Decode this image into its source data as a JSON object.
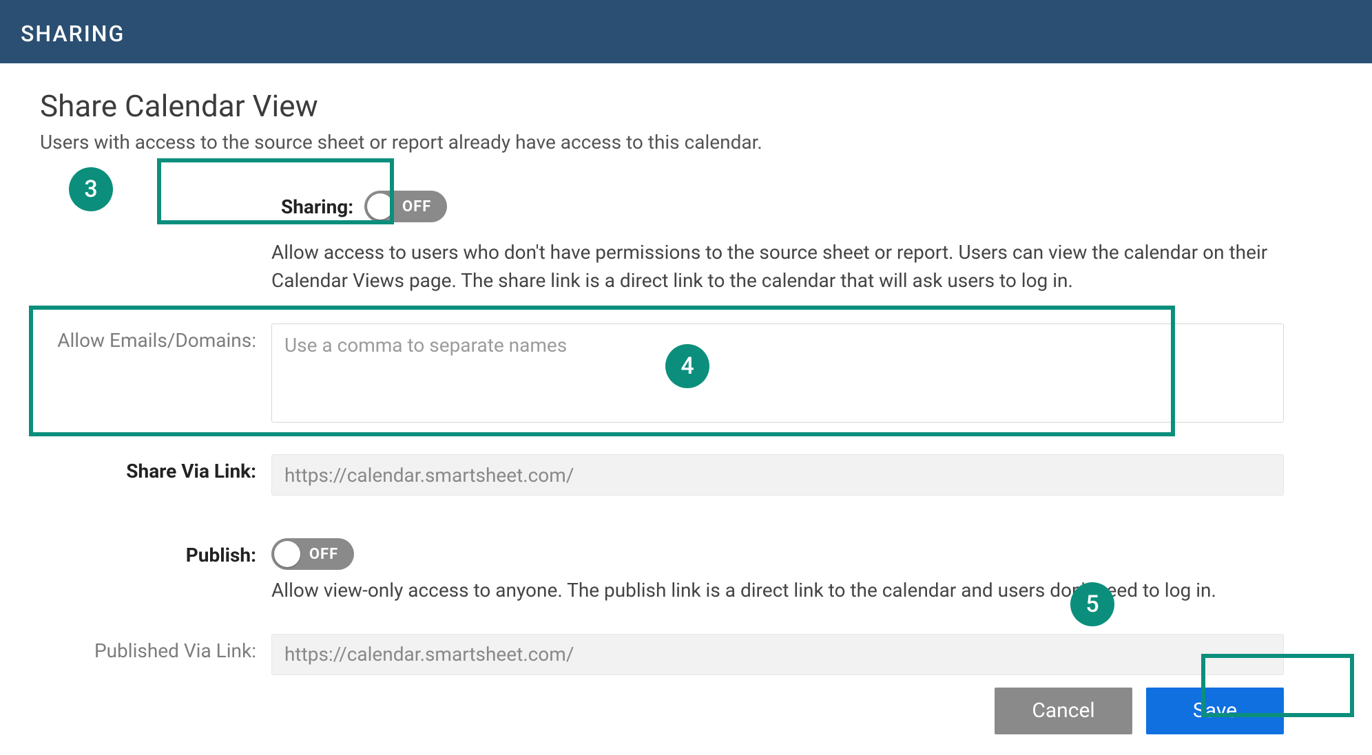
{
  "header": {
    "title": "SHARING"
  },
  "panel": {
    "heading": "Share Calendar View",
    "subheading": "Users with access to the source sheet or report already have access to this calendar."
  },
  "sharing": {
    "label": "Sharing:",
    "toggle_state": "OFF",
    "description": "Allow access to users who don't have permissions to the source sheet or report. Users can view the calendar on their Calendar Views page. The share link is a direct link to the calendar that will ask users to log in."
  },
  "allow": {
    "label": "Allow Emails/Domains:",
    "placeholder": "Use a comma to separate names",
    "value": ""
  },
  "share_link": {
    "label": "Share Via Link:",
    "value": "https://calendar.smartsheet.com/"
  },
  "publish": {
    "label": "Publish:",
    "toggle_state": "OFF",
    "description": "Allow view-only access to anyone. The publish link is a direct link to the calendar and users don't need to log in."
  },
  "published_link": {
    "label": "Published Via Link:",
    "value": "https://calendar.smartsheet.com/"
  },
  "buttons": {
    "cancel": "Cancel",
    "save": "Save"
  },
  "annotations": {
    "n3": "3",
    "n4": "4",
    "n5": "5"
  },
  "colors": {
    "header_bg": "#2a4f72",
    "accent": "#0b8f7c",
    "primary_button": "#1070e0",
    "secondary_button": "#8a8a8a"
  }
}
